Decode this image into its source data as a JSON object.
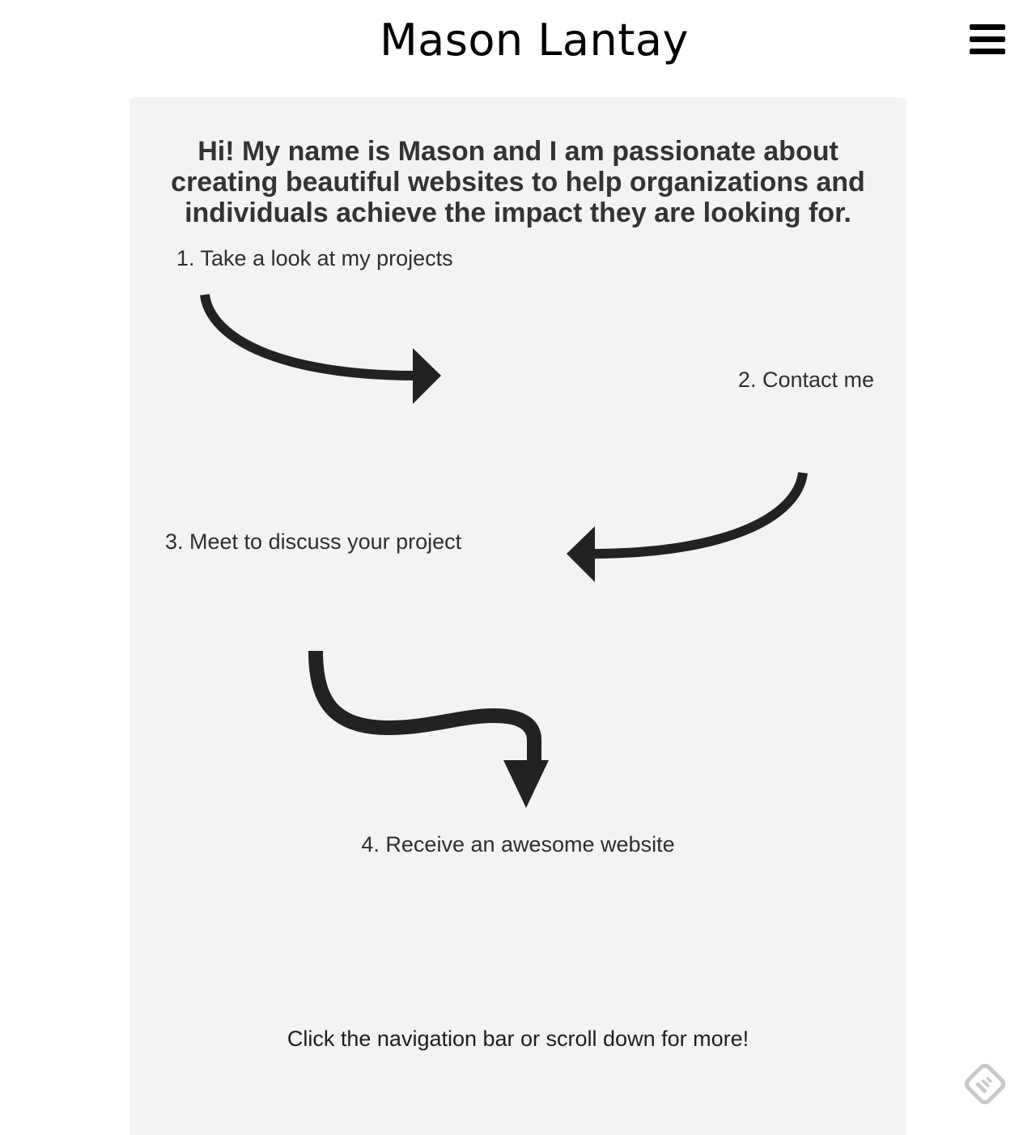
{
  "header": {
    "title": "Mason Lantay",
    "menu_icon": "hamburger-menu-icon"
  },
  "main": {
    "intro": "Hi! My name is Mason and I am passionate about creating beautiful websites to help organizations and individuals achieve the impact they are looking for.",
    "steps": [
      {
        "label": "1. Take a look at my projects"
      },
      {
        "label": "2. Contact me"
      },
      {
        "label": "3. Meet to discuss your project"
      },
      {
        "label": "4. Receive an awesome website"
      }
    ],
    "cta": "Click the navigation bar or scroll down for more!"
  },
  "floating": {
    "icon": "feedly-icon"
  },
  "colors": {
    "card_background": "#f3f3f3",
    "text": "#333333",
    "arrow": "#222222"
  }
}
